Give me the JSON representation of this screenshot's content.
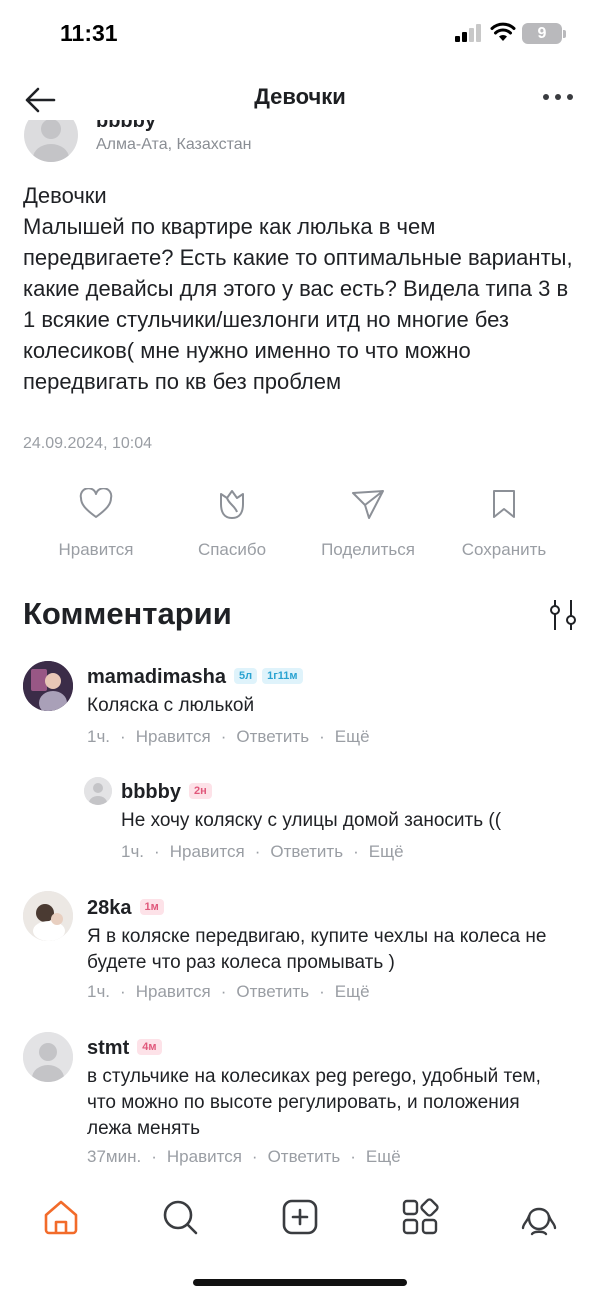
{
  "status_bar": {
    "time": "11:31",
    "battery": "9"
  },
  "header": {
    "title": "Девочки"
  },
  "author": {
    "name": "bbbby",
    "location": "Алма-Ата, Казахстан"
  },
  "post": {
    "text": "Девочки\nМалышей по квартире как люлька в чем передвигаете? Есть какие то оптимальные варианты, какие девайсы для этого у вас есть? Видела типа 3 в 1 всякие стульчики/шезлонги итд но многие без колесиков( мне нужно именно то что можно передвигать по кв без проблем",
    "date": "24.09.2024, 10:04"
  },
  "actions": {
    "like": "Нравится",
    "thanks": "Спасибо",
    "share": "Поделиться",
    "save": "Сохранить"
  },
  "comments_title": "Комментарии",
  "comment_actions": {
    "like": "Нравится",
    "reply": "Ответить",
    "more": "Ещё"
  },
  "comments": [
    {
      "name": "mamadimasha",
      "badges": [
        "5л",
        "1г11м"
      ],
      "badge_color": "blue",
      "text": "Коляска с люлькой",
      "time": "1ч."
    },
    {
      "name": "bbbby",
      "badges": [
        "2н"
      ],
      "badge_color": "pink",
      "text": "Не хочу коляску с улицы домой заносить ((",
      "time": "1ч."
    },
    {
      "name": "28ka",
      "badges": [
        "1м"
      ],
      "badge_color": "pink",
      "text": "Я в коляске передвигаю, купите чехлы на колеса не будете что раз колеса промывать )",
      "time": "1ч."
    },
    {
      "name": "stmt",
      "badges": [
        "4м"
      ],
      "badge_color": "pink",
      "text": "в стульчике на колесиках peg perego, удобный тем, что можно по высоте регулировать, и положения лежа менять",
      "time": "37мин."
    }
  ],
  "colors": {
    "accent": "#f26b2a",
    "muted": "#9a9ea4",
    "text": "#1f2125"
  },
  "bottom_nav": [
    "home-icon",
    "search-icon",
    "add-icon",
    "services-icon",
    "profile-icon"
  ]
}
